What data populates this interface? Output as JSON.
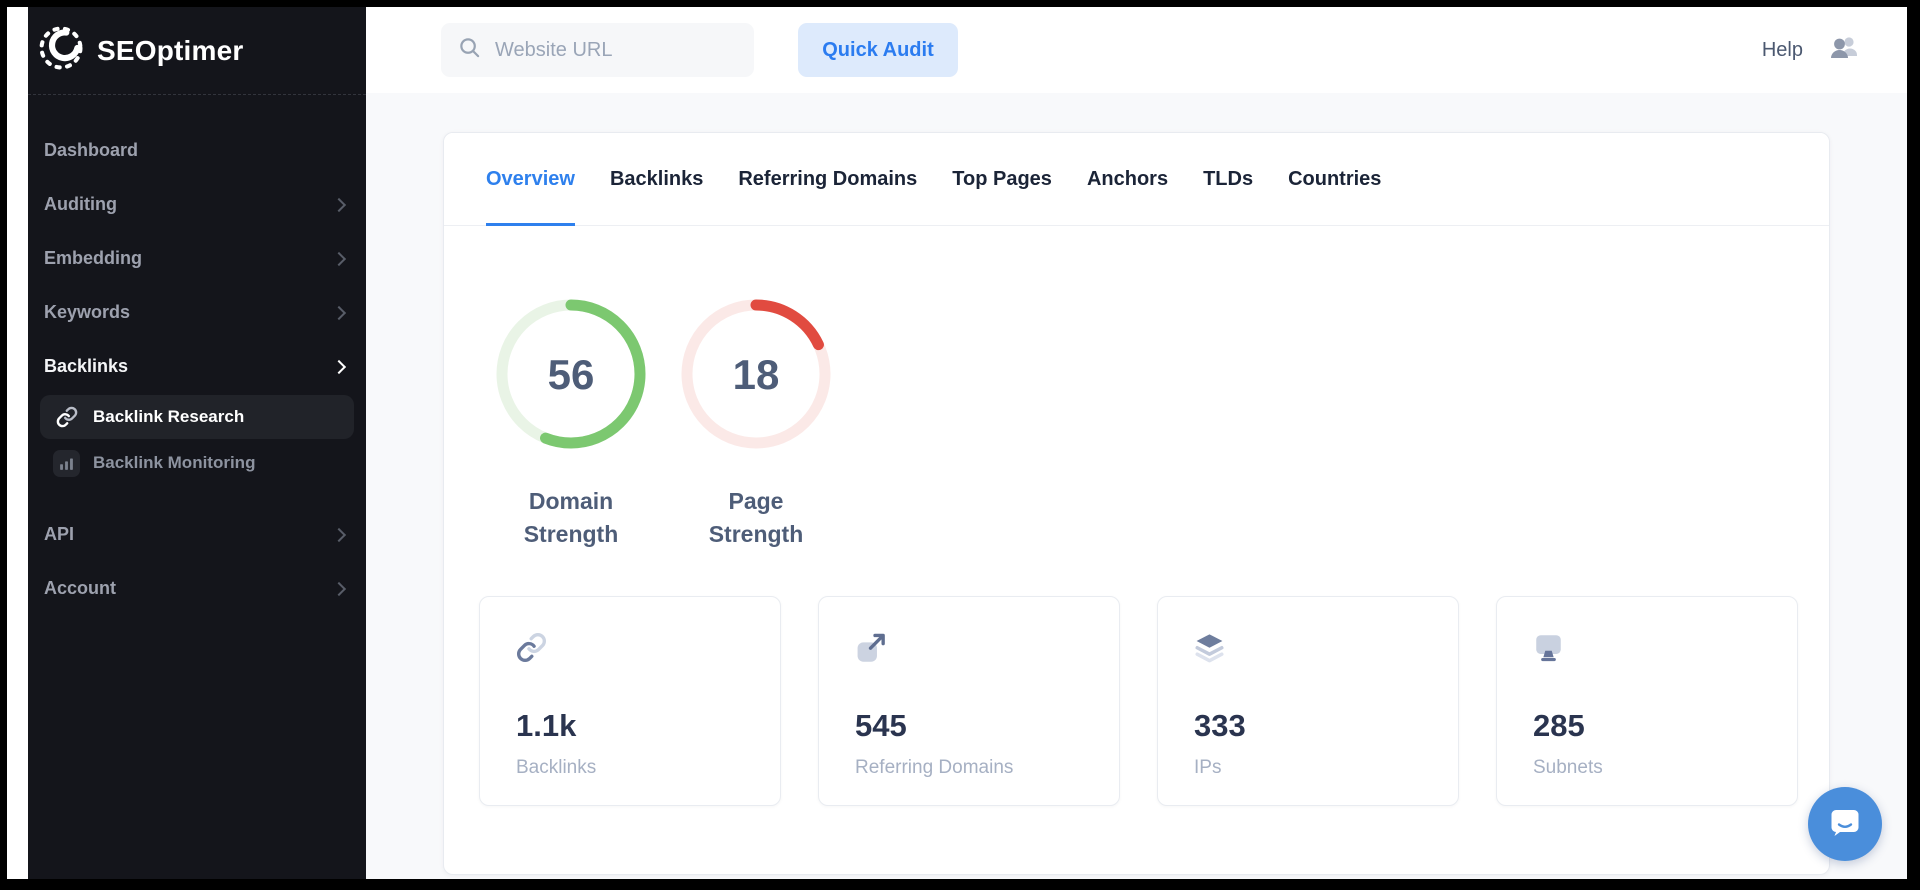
{
  "brand": {
    "name": "SEOptimer",
    "logo_icon": "gear-logo-icon"
  },
  "topbar": {
    "search_placeholder": "Website URL",
    "search_icon": "search-icon",
    "quick_audit_label": "Quick Audit",
    "help_label": "Help",
    "account_icon": "users-icon"
  },
  "sidebar": {
    "items_top": [
      {
        "label": "Dashboard",
        "chevron": false
      },
      {
        "label": "Auditing",
        "chevron": true
      },
      {
        "label": "Embedding",
        "chevron": true
      },
      {
        "label": "Keywords",
        "chevron": true
      },
      {
        "label": "Backlinks",
        "chevron": true,
        "active": true
      }
    ],
    "subitems": [
      {
        "label": "Backlink Research",
        "icon": "link-icon",
        "selected": true
      },
      {
        "label": "Backlink Monitoring",
        "icon": "bar-chart-icon",
        "selected": false
      }
    ],
    "items_bottom": [
      {
        "label": "API",
        "chevron": true
      },
      {
        "label": "Account",
        "chevron": true
      }
    ]
  },
  "tabs": [
    {
      "label": "Overview",
      "active": true
    },
    {
      "label": "Backlinks",
      "active": false
    },
    {
      "label": "Referring Domains",
      "active": false
    },
    {
      "label": "Top Pages",
      "active": false
    },
    {
      "label": "Anchors",
      "active": false
    },
    {
      "label": "TLDs",
      "active": false
    },
    {
      "label": "Countries",
      "active": false
    }
  ],
  "chart_data": {
    "type": "gauge",
    "gauges": [
      {
        "label": "Domain Strength",
        "value": 56,
        "max": 100,
        "color": "#7cc870",
        "track_color": "#e9f4e6"
      },
      {
        "label": "Page Strength",
        "value": 18,
        "max": 100,
        "color": "#e14b40",
        "track_color": "#fbe9e7"
      }
    ]
  },
  "stats": [
    {
      "value": "1.1k",
      "label": "Backlinks",
      "icon": "link-icon"
    },
    {
      "value": "545",
      "label": "Referring Domains",
      "icon": "external-link-icon"
    },
    {
      "value": "333",
      "label": "IPs",
      "icon": "layers-icon"
    },
    {
      "value": "285",
      "label": "Subnets",
      "icon": "monitor-icon"
    }
  ],
  "chat": {
    "icon": "chat-bubble-icon"
  },
  "colors": {
    "accent_blue": "#2e80ed",
    "quick_audit_bg": "#ddeafc",
    "sidebar_bg": "#14151b",
    "page_bg": "#f8f9fb",
    "gauge_green": "#7cc870",
    "gauge_red": "#e14b40",
    "slate_text": "#4e5d78",
    "stat_number": "#2a344f",
    "chat_blue": "#4a8edb"
  }
}
